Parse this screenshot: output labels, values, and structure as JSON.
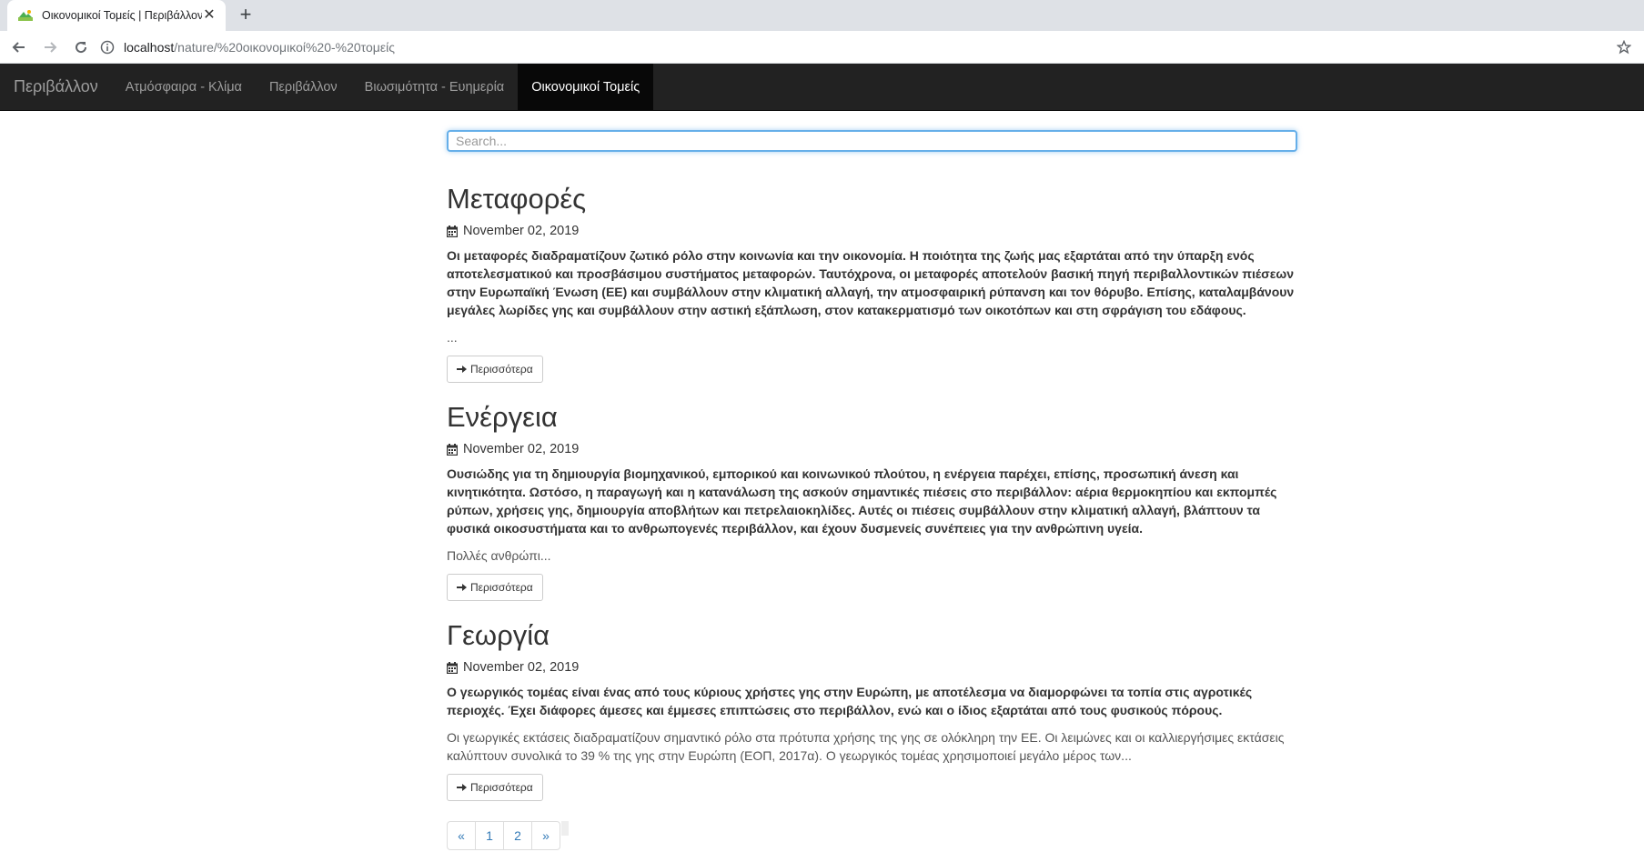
{
  "browser": {
    "tab_title": "Οικονομικοί Τομείς | Περιβάλλον",
    "url_host": "localhost",
    "url_path": "/nature/%20οικονομικοί%20-%20τομείς"
  },
  "navbar": {
    "brand": "Περιβάλλον",
    "items": [
      {
        "label": "Ατμόσφαιρα - Κλίμα"
      },
      {
        "label": "Περιβάλλον"
      },
      {
        "label": "Βιωσιμότητα - Ευημερία"
      },
      {
        "label": "Οικονομικοί Τομείς"
      }
    ],
    "active_index": 3
  },
  "search": {
    "placeholder": "Search...",
    "value": ""
  },
  "posts": [
    {
      "title": "Μεταφορές",
      "date": "November 02, 2019",
      "lead": "Οι μεταφορές διαδραματίζουν ζωτικό ρόλο στην κοινωνία και την οικονομία. Η ποιότητα της ζωής μας εξαρτάται από την ύπαρξη ενός αποτελεσματικού και προσβάσιμου συστήματος μεταφορών. Ταυτόχρονα, οι μεταφορές αποτελούν βασική πηγή περιβαλλοντικών πιέσεων στην Ευρωπαϊκή Ένωση (ΕΕ) και συμβάλλουν στην κλιματική αλλαγή, την ατμοσφαιρική ρύπανση και τον θόρυβο. Επίσης, καταλαμβάνουν μεγάλες λωρίδες γης και συμβάλλουν στην αστική εξάπλωση, στον κατακερματισμό των οικοτόπων και στη σφράγιση του εδάφους.",
      "excerpt": "...",
      "button": "Περισσότερα"
    },
    {
      "title": "Ενέργεια",
      "date": "November 02, 2019",
      "lead": "Ουσιώδης για τη δημιουργία βιομηχανικού, εμπορικού και κοινωνικού πλούτου, η ενέργεια παρέχει, επίσης, προσωπική άνεση και κινητικότητα. Ωστόσο, η παραγωγή και η κατανάλωση της ασκούν σημαντικές πιέσεις στο περιβάλλον: αέρια θερμοκηπίου και εκπομπές ρύπων, χρήσεις γης, δημιουργία αποβλήτων και πετρελαιοκηλίδες. Αυτές οι πιέσεις συμβάλλουν στην κλιματική αλλαγή, βλάπτουν τα φυσικά οικοσυστήματα και το ανθρωπογενές περιβάλλον, και έχουν δυσμενείς συνέπειες για την ανθρώπινη υγεία.",
      "excerpt": "Πολλές ανθρώπι...",
      "button": "Περισσότερα"
    },
    {
      "title": "Γεωργία",
      "date": "November 02, 2019",
      "lead": "Ο γεωργικός τομέας είναι ένας από τους κύριους χρήστες γης στην Ευρώπη, με αποτέλεσμα να διαμορφώνει τα τοπία στις αγροτικές περιοχές. Έχει διάφορες άμεσες και έμμεσες επιπτώσεις στο περιβάλλον, ενώ και ο ίδιος εξαρτάται από τους φυσικούς πόρους.",
      "excerpt": "Οι γεωργικές εκτάσεις διαδραματίζουν σημαντικό ρόλο στα πρότυπα χρήσης της γης σε ολόκληρη την ΕΕ. Οι λειμώνες και οι καλλιεργήσιμες εκτάσεις καλύπτουν συνολικά το 39 % της γης στην Ευρώπη (ΕΟΠ, 2017α). Ο γεωργικός τομέας χρησιμοποιεί μεγάλο μέρος των...",
      "button": "Περισσότερα"
    }
  ],
  "pagination": {
    "prev": "«",
    "pages": [
      "1",
      "2"
    ],
    "next": "»"
  },
  "colors": {
    "navbar_bg": "#222222",
    "active_bg": "#080808",
    "link": "#337ab7",
    "focus": "#66afe9"
  }
}
